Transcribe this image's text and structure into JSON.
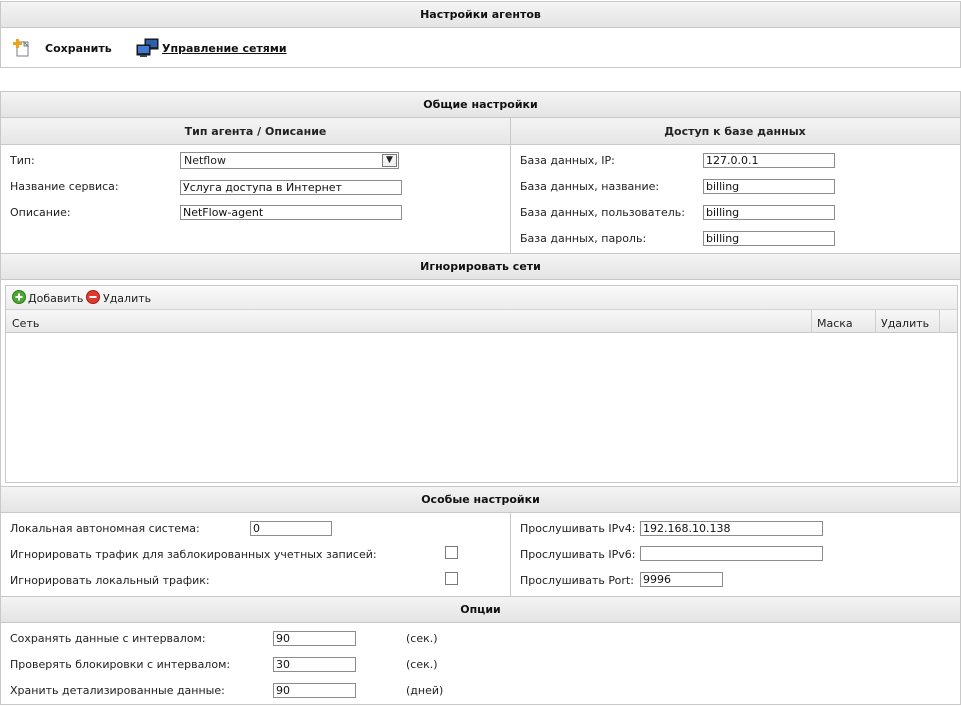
{
  "top": {
    "title": "Настройки агентов",
    "save_label": "Сохранить",
    "networks_label": "Управление сетями"
  },
  "general": {
    "title": "Общие настройки",
    "left_title": "Тип агента / Описание",
    "right_title": "Доступ к базе данных",
    "type_label": "Тип:",
    "type_value": "Netflow",
    "service_label": "Название сервиса:",
    "service_value": "Услуга доступа в Интернет",
    "desc_label": "Описание:",
    "desc_value": "NetFlow-agent",
    "db_ip_label": "База данных, IP:",
    "db_ip_value": "127.0.0.1",
    "db_name_label": "База данных, название:",
    "db_name_value": "billing",
    "db_user_label": "База данных, пользователь:",
    "db_user_value": "billing",
    "db_pass_label": "База данных, пароль:",
    "db_pass_value": "billing"
  },
  "ignore": {
    "title": "Игнорировать сети",
    "add_label": "Добавить",
    "delete_label": "Удалить",
    "columns": [
      "Сеть",
      "Маска",
      "Удалить"
    ]
  },
  "special": {
    "title": "Особые настройки",
    "las_label": "Локальная автономная система:",
    "las_value": "0",
    "ignore_blocked_label": "Игнорировать трафик для заблокированных учетных записей:",
    "ignore_local_label": "Игнорировать локальный трафик:",
    "ipv4_label": "Прослушивать IPv4:",
    "ipv4_value": "192.168.10.138",
    "ipv6_label": "Прослушивать IPv6:",
    "ipv6_value": "",
    "port_label": "Прослушивать Port:",
    "port_value": "9996"
  },
  "options": {
    "title": "Опции",
    "save_interval_label": "Сохранять данные с интервалом:",
    "save_interval_value": "90",
    "save_interval_unit": "(сек.)",
    "block_interval_label": "Проверять блокировки с интервалом:",
    "block_interval_value": "30",
    "block_interval_unit": "(сек.)",
    "keep_detail_label": "Хранить детализированные данные:",
    "keep_detail_value": "90",
    "keep_detail_unit": "(дней)"
  }
}
